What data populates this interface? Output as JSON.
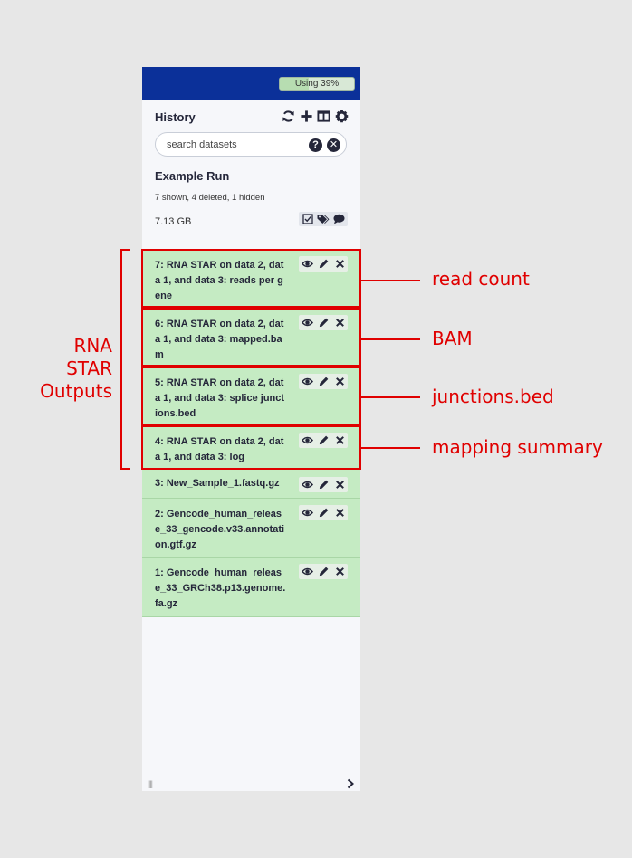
{
  "quota": {
    "label": "Using 39%",
    "percent": 39
  },
  "history": {
    "title": "History",
    "search_placeholder": "search datasets",
    "name": "Example Run",
    "stats": "7 shown, 4 deleted, 1 hidden",
    "size": "7.13 GB"
  },
  "datasets": [
    {
      "title": "7: RNA STAR on data 2, data 1, and data 3: reads per gene"
    },
    {
      "title": "6: RNA STAR on data 2, data 1, and data 3: mapped.bam"
    },
    {
      "title": "5: RNA STAR on data 2, data 1, and data 3: splice junctions.bed"
    },
    {
      "title": "4: RNA STAR on data 2, data 1, and data 3: log"
    },
    {
      "title": "3: New_Sample_1.fastq.gz"
    },
    {
      "title": "2: Gencode_human_release_33_gencode.v33.annotation.gtf.gz"
    },
    {
      "title": "1: Gencode_human_release_33_GRCh38.p13.genome.fa.gz"
    }
  ],
  "annotations": {
    "group_label": "RNA STAR Outputs",
    "labels": [
      "read count",
      "BAM",
      "junctions.bed",
      "mapping summary"
    ]
  },
  "colors": {
    "topbar": "#0b3099",
    "dataset_ok": "#c5ebc3",
    "annotation": "#e00000"
  }
}
